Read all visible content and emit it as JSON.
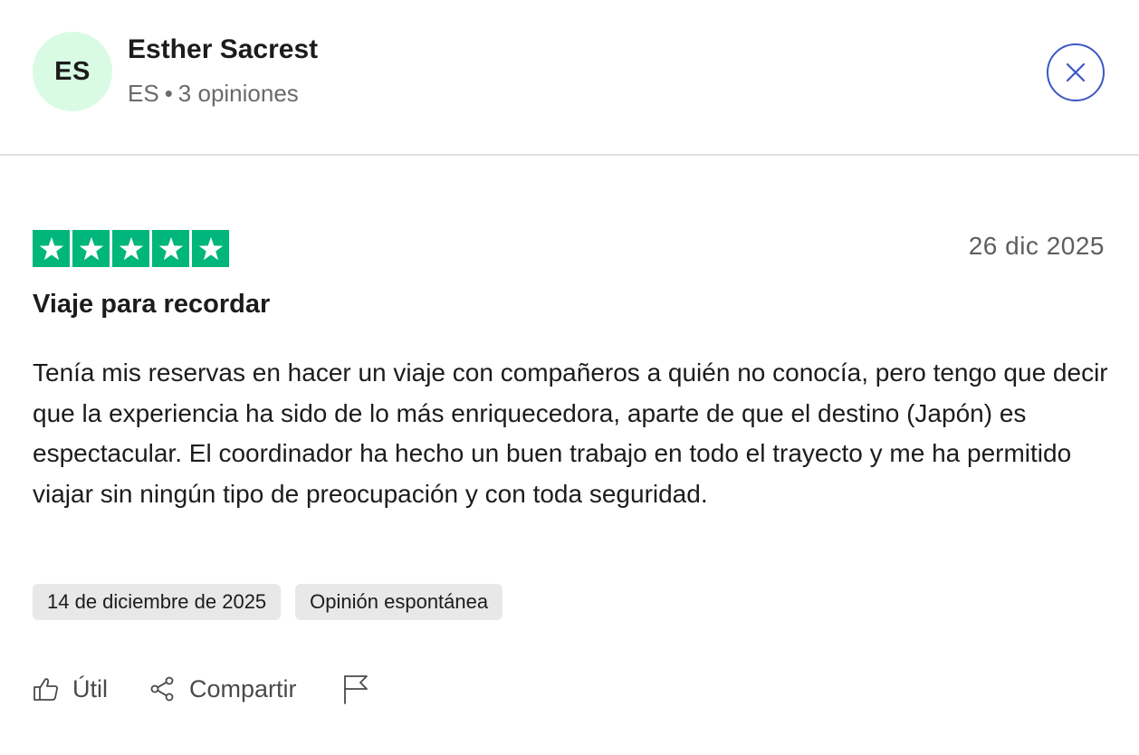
{
  "reviewer": {
    "initials": "ES",
    "name": "Esther Sacrest",
    "country": "ES",
    "separator": "•",
    "reviews_count": "3 opiniones"
  },
  "close": {
    "icon": "close-icon"
  },
  "review": {
    "rating": 5,
    "max_rating": 5,
    "date": "26 dic 2025",
    "title": "Viaje para recordar",
    "body": "Tenía mis reservas en hacer un viaje con compañeros a quién no conocía, pero tengo que decir que la experiencia ha sido de lo más enriquecedora, aparte de que el destino (Japón) es espectacular. El coordinador ha hecho un buen trabajo en todo el trayecto y me ha permitido viajar sin ningún tipo de preocupación y con toda seguridad.",
    "experience_date": "14 de diciembre de 2025",
    "review_type": "Opinión espontánea"
  },
  "actions": {
    "useful_label": "Útil",
    "share_label": "Compartir",
    "useful_icon": "thumbs-up-icon",
    "share_icon": "share-icon",
    "report_icon": "flag-icon"
  },
  "colors": {
    "star_green": "#00b67a",
    "avatar_bg": "#d9fbe3",
    "close_blue": "#3c57c4",
    "chip_bg": "#e8e8e8"
  }
}
